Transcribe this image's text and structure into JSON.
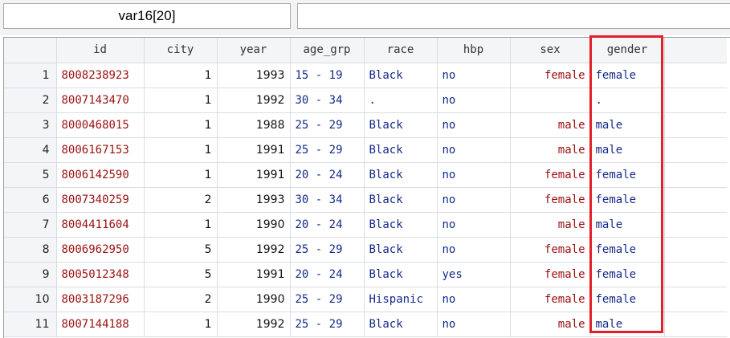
{
  "toolbar": {
    "variable_name": "var16[20]",
    "cell_value": ""
  },
  "table": {
    "columns": [
      "id",
      "city",
      "year",
      "age_grp",
      "race",
      "hbp",
      "sex",
      "gender"
    ],
    "rows": [
      {
        "n": "1",
        "id": "8008238923",
        "city": "1",
        "year": "1993",
        "age_grp": "15 - 19",
        "race": "Black",
        "hbp": "no",
        "sex": "female",
        "gender": "female"
      },
      {
        "n": "2",
        "id": "8007143470",
        "city": "1",
        "year": "1992",
        "age_grp": "30 - 34",
        "race": ".",
        "hbp": "no",
        "sex": "",
        "gender": "."
      },
      {
        "n": "3",
        "id": "8000468015",
        "city": "1",
        "year": "1988",
        "age_grp": "25 - 29",
        "race": "Black",
        "hbp": "no",
        "sex": "male",
        "gender": "male"
      },
      {
        "n": "4",
        "id": "8006167153",
        "city": "1",
        "year": "1991",
        "age_grp": "25 - 29",
        "race": "Black",
        "hbp": "no",
        "sex": "male",
        "gender": "male"
      },
      {
        "n": "5",
        "id": "8006142590",
        "city": "1",
        "year": "1991",
        "age_grp": "20 - 24",
        "race": "Black",
        "hbp": "no",
        "sex": "female",
        "gender": "female"
      },
      {
        "n": "6",
        "id": "8007340259",
        "city": "2",
        "year": "1993",
        "age_grp": "30 - 34",
        "race": "Black",
        "hbp": "no",
        "sex": "female",
        "gender": "female"
      },
      {
        "n": "7",
        "id": "8004411604",
        "city": "1",
        "year": "1990",
        "age_grp": "20 - 24",
        "race": "Black",
        "hbp": "no",
        "sex": "male",
        "gender": "male"
      },
      {
        "n": "8",
        "id": "8006962950",
        "city": "5",
        "year": "1992",
        "age_grp": "25 - 29",
        "race": "Black",
        "hbp": "no",
        "sex": "female",
        "gender": "female"
      },
      {
        "n": "9",
        "id": "8005012348",
        "city": "5",
        "year": "1991",
        "age_grp": "20 - 24",
        "race": "Black",
        "hbp": "yes",
        "sex": "female",
        "gender": "female"
      },
      {
        "n": "10",
        "id": "8003187296",
        "city": "2",
        "year": "1990",
        "age_grp": "25 - 29",
        "race": "Hispanic",
        "hbp": "no",
        "sex": "female",
        "gender": "female"
      },
      {
        "n": "11",
        "id": "8007144188",
        "city": "1",
        "year": "1992",
        "age_grp": "25 - 29",
        "race": "Black",
        "hbp": "no",
        "sex": "male",
        "gender": "male"
      }
    ]
  },
  "colors": {
    "highlight": "#e3202a",
    "string_text": "#9b1010",
    "label_text": "#152a8a"
  }
}
